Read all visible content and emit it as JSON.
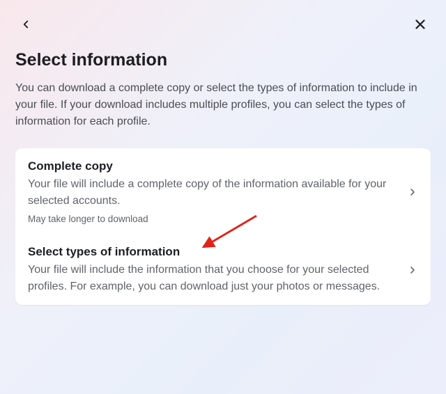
{
  "page": {
    "title": "Select information",
    "subtitle": "You can download a complete copy or select the types of information to include in your file. If your download includes multiple profiles, you can select the types of information for each profile."
  },
  "options": {
    "complete": {
      "title": "Complete copy",
      "description": "Your file will include a complete copy of the information available for your selected accounts.",
      "note": "May take longer to download"
    },
    "select": {
      "title": "Select types of information",
      "description": "Your file will include the information that you choose for your selected profiles. For example, you can download just your photos or messages."
    }
  }
}
